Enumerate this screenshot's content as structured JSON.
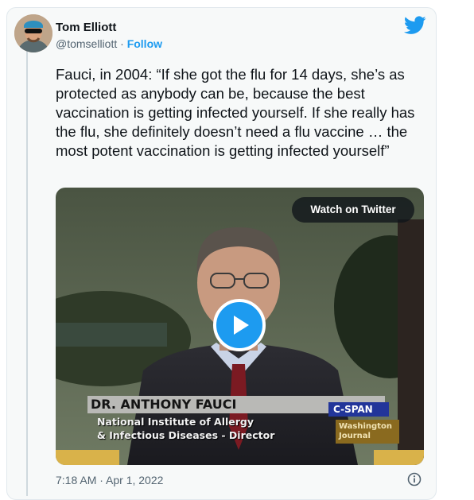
{
  "tweet": {
    "author_name": "Tom Elliott",
    "handle": "@tomselliott",
    "separator": " · ",
    "follow_label": "Follow",
    "text": "Fauci, in 2004: “If she got the flu for 14 days, she’s as protected as anybody can be, because the best vaccination is getting infected yourself. If she really has the flu, she definitely doesn’t need a flu vaccine … the most potent vaccination is getting infected yourself”",
    "timestamp": "7:18 AM · Apr 1, 2022"
  },
  "media": {
    "watch_label": "Watch on Twitter",
    "chyron_name": "DR. ANTHONY FAUCI",
    "chyron_line1": "National Institute of Allergy",
    "chyron_line2": "& Infectious Diseases - Director",
    "network": "C-SPAN",
    "program_line1": "Washington",
    "program_line2": "Journal"
  },
  "icons": {
    "brand": "twitter-bird-icon",
    "play": "play-icon",
    "info": "info-icon"
  },
  "colors": {
    "accent": "#1d9bf0",
    "text": "#0f1419",
    "secondary": "#536471",
    "card_bg": "#f7f9f9"
  }
}
